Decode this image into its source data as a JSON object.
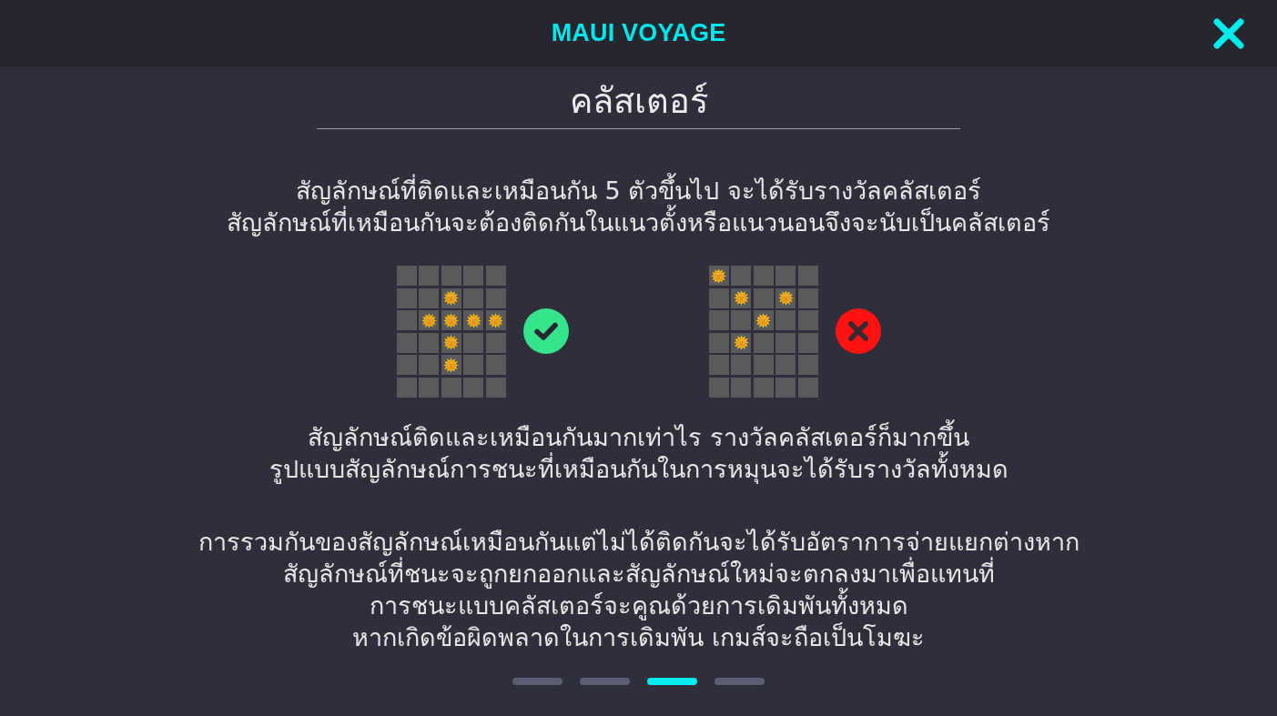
{
  "header": {
    "title": "MAUI VOYAGE"
  },
  "section_title": "คลัสเตอร์",
  "intro": [
    "สัญลักษณ์ที่ติดและเหมือนกัน 5 ตัวขึ้นไป จะได้รับรางวัลคลัสเตอร์",
    "สัญลักษณ์ที่เหมือนกันจะต้องติดกันในแนวตั้งหรือแนวนอนจึงจะนับเป็นคลัสเตอร์"
  ],
  "examples": [
    {
      "valid": true,
      "grid": [
        [
          {
            "symbol": false
          },
          {
            "symbol": false
          },
          {
            "symbol": false
          },
          {
            "symbol": false
          },
          {
            "symbol": false
          }
        ],
        [
          {
            "symbol": false
          },
          {
            "symbol": false
          },
          {
            "symbol": true
          },
          {
            "symbol": false
          },
          {
            "symbol": false
          }
        ],
        [
          {
            "symbol": false
          },
          {
            "symbol": true
          },
          {
            "symbol": true
          },
          {
            "symbol": true
          },
          {
            "symbol": true
          }
        ],
        [
          {
            "symbol": false
          },
          {
            "symbol": false
          },
          {
            "symbol": true
          },
          {
            "symbol": false
          },
          {
            "symbol": false
          }
        ],
        [
          {
            "symbol": false
          },
          {
            "symbol": false
          },
          {
            "symbol": true
          },
          {
            "symbol": false
          },
          {
            "symbol": false
          }
        ],
        [
          {
            "symbol": false
          },
          {
            "symbol": false
          },
          {
            "symbol": false
          },
          {
            "symbol": false
          },
          {
            "symbol": false
          }
        ]
      ]
    },
    {
      "valid": false,
      "grid": [
        [
          {
            "symbol": true
          },
          {
            "symbol": false
          },
          {
            "symbol": false
          },
          {
            "symbol": false
          },
          {
            "symbol": false
          }
        ],
        [
          {
            "symbol": false
          },
          {
            "symbol": true
          },
          {
            "symbol": false
          },
          {
            "symbol": true
          },
          {
            "symbol": false
          }
        ],
        [
          {
            "symbol": false
          },
          {
            "symbol": false
          },
          {
            "symbol": true
          },
          {
            "symbol": false
          },
          {
            "symbol": false
          }
        ],
        [
          {
            "symbol": false
          },
          {
            "symbol": true
          },
          {
            "symbol": false
          },
          {
            "symbol": false
          },
          {
            "symbol": false
          }
        ],
        [
          {
            "symbol": false
          },
          {
            "symbol": false
          },
          {
            "symbol": false
          },
          {
            "symbol": false
          },
          {
            "symbol": false
          }
        ],
        [
          {
            "symbol": false
          },
          {
            "symbol": false
          },
          {
            "symbol": false
          },
          {
            "symbol": false
          },
          {
            "symbol": false
          }
        ]
      ]
    }
  ],
  "details": [
    [
      "สัญลักษณ์ติดและเหมือนกันมากเท่าไร รางวัลคลัสเตอร์ก็มากขึ้น",
      "รูปแบบสัญลักษณ์การชนะที่เหมือนกันในการหมุนจะได้รับรางวัลทั้งหมด"
    ],
    [
      "การรวมกันของสัญลักษณ์เหมือนกันแต่ไม่ได้ติดกันจะได้รับอัตราการจ่ายแยกต่างหาก",
      "สัญลักษณ์ที่ชนะจะถูกยกออกและสัญลักษณ์ใหม่จะตกลงมาเพื่อแทนที่",
      "การชนะแบบคลัสเตอร์จะคูณด้วยการเดิมพันทั้งหมด",
      "หากเกิดข้อผิดพลาดในการเดิมพัน เกมส์จะถือเป็นโมฆะ"
    ]
  ],
  "pages": [
    {
      "selected": false
    },
    {
      "selected": false
    },
    {
      "selected": true
    },
    {
      "selected": false
    }
  ]
}
